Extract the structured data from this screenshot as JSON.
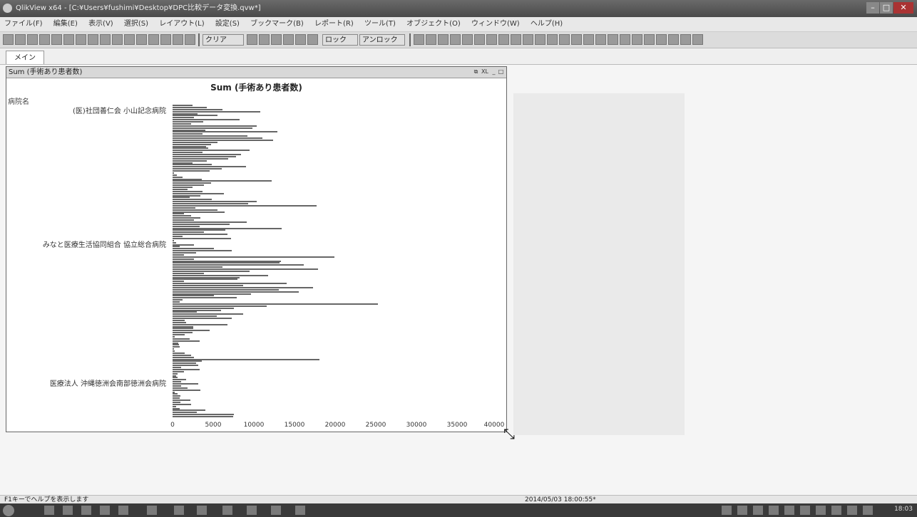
{
  "window": {
    "title": "QlikView x64 - [C:¥Users¥fushimi¥Desktop¥DPC比較データ変換.qvw*]",
    "minimize": "–",
    "maximize": "□",
    "close": "✕"
  },
  "menu": [
    "ファイル(F)",
    "編集(E)",
    "表示(V)",
    "選択(S)",
    "レイアウト(L)",
    "設定(S)",
    "ブックマーク(B)",
    "レポート(R)",
    "ツール(T)",
    "オブジェクト(O)",
    "ウィンドウ(W)",
    "ヘルプ(H)"
  ],
  "toolbar": {
    "clear_label": "クリア",
    "lock_label": "ロック",
    "unlock_label": "アンロック"
  },
  "tabs": [
    {
      "label": "メイン"
    }
  ],
  "chart_object": {
    "caption": "Sum (手術あり患者数)",
    "ctl_a": "⧉",
    "ctl_b": "XL",
    "ctl_min": "_",
    "ctl_max": "□",
    "dimension_label": "病院名"
  },
  "chart_data": {
    "type": "bar",
    "orientation": "horizontal",
    "title": "Sum (手術あり患者数)",
    "xlabel": "",
    "ylabel": "病院名",
    "xlim": [
      0,
      40000
    ],
    "x_ticks": [
      "0",
      "5000",
      "10000",
      "15000",
      "20000",
      "25000",
      "30000",
      "35000",
      "40000"
    ],
    "visible_category_labels": [
      "(医)社団善仁会 小山記念病院",
      "みなと医療生活協同組合 協立総合病院",
      "医療法人 沖縄徳洲会南部徳洲会病院"
    ],
    "values": [
      2500,
      4300,
      6200,
      10900,
      3100,
      5600,
      2700,
      8300,
      3800,
      2300,
      10500,
      9900,
      4100,
      13000,
      3700,
      9300,
      11200,
      12500,
      5600,
      4800,
      4200,
      4400,
      9600,
      3700,
      8500,
      7900,
      6900,
      4300,
      2500,
      4900,
      9100,
      6100,
      4600,
      200,
      500,
      1200,
      3600,
      12300,
      4800,
      3900,
      2500,
      1900,
      3700,
      6400,
      3500,
      2100,
      4900,
      10500,
      9400,
      17900,
      2800,
      5600,
      6500,
      1400,
      2300,
      3500,
      2700,
      9200,
      7100,
      3400,
      13600,
      6600,
      3900,
      6800,
      1200,
      7300,
      200,
      400,
      2700,
      900,
      5100,
      7400,
      2900,
      1400,
      20100,
      2700,
      13500,
      13300,
      16300,
      6200,
      18100,
      9600,
      3900,
      11900,
      8300,
      8100,
      1400,
      14200,
      8800,
      17500,
      13200,
      15700,
      9800,
      5100,
      8000,
      1200,
      900,
      25500,
      11700,
      7600,
      6000,
      3000,
      8800,
      5500,
      7400,
      1500,
      1700,
      6800,
      2600,
      2600,
      4600,
      2500,
      1500,
      300,
      2100,
      3400,
      700,
      800,
      900,
      200,
      300,
      1500,
      2300,
      2700,
      18300,
      3600,
      2900,
      3200,
      1100,
      3400,
      1400,
      600,
      400,
      600,
      1700,
      1100,
      3200,
      1100,
      1900,
      3500,
      300,
      600,
      1000,
      900,
      2200,
      1000,
      2300,
      400,
      900,
      4100,
      3000,
      7600,
      7500
    ]
  },
  "status": {
    "help": "F1キーでヘルプを表示します",
    "timestamp": "2014/05/03 18:00:55*"
  },
  "taskbar": {
    "clock": "18:03"
  }
}
